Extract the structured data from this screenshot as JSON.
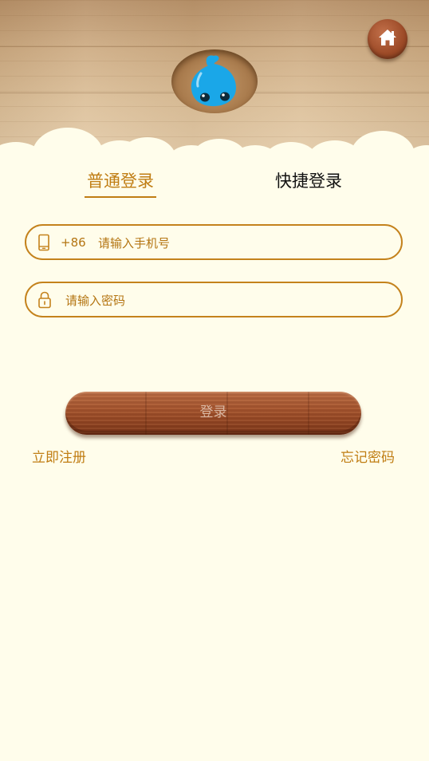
{
  "header": {
    "home_icon": "home-icon",
    "mascot": "blue-droplet-mascot"
  },
  "tabs": [
    {
      "label": "普通登录",
      "active": true
    },
    {
      "label": "快捷登录",
      "active": false
    }
  ],
  "phone": {
    "icon": "phone-icon",
    "country_code": "+86",
    "value": "",
    "placeholder": "请输入手机号"
  },
  "password": {
    "icon": "lock-icon",
    "value": "",
    "placeholder": "请输入密码"
  },
  "login_label": "登录",
  "links": {
    "register": "立即注册",
    "forgot": "忘记密码"
  },
  "colors": {
    "accent": "#c07d13",
    "background": "#fffdeb",
    "button_wood": "#9c4a27"
  }
}
